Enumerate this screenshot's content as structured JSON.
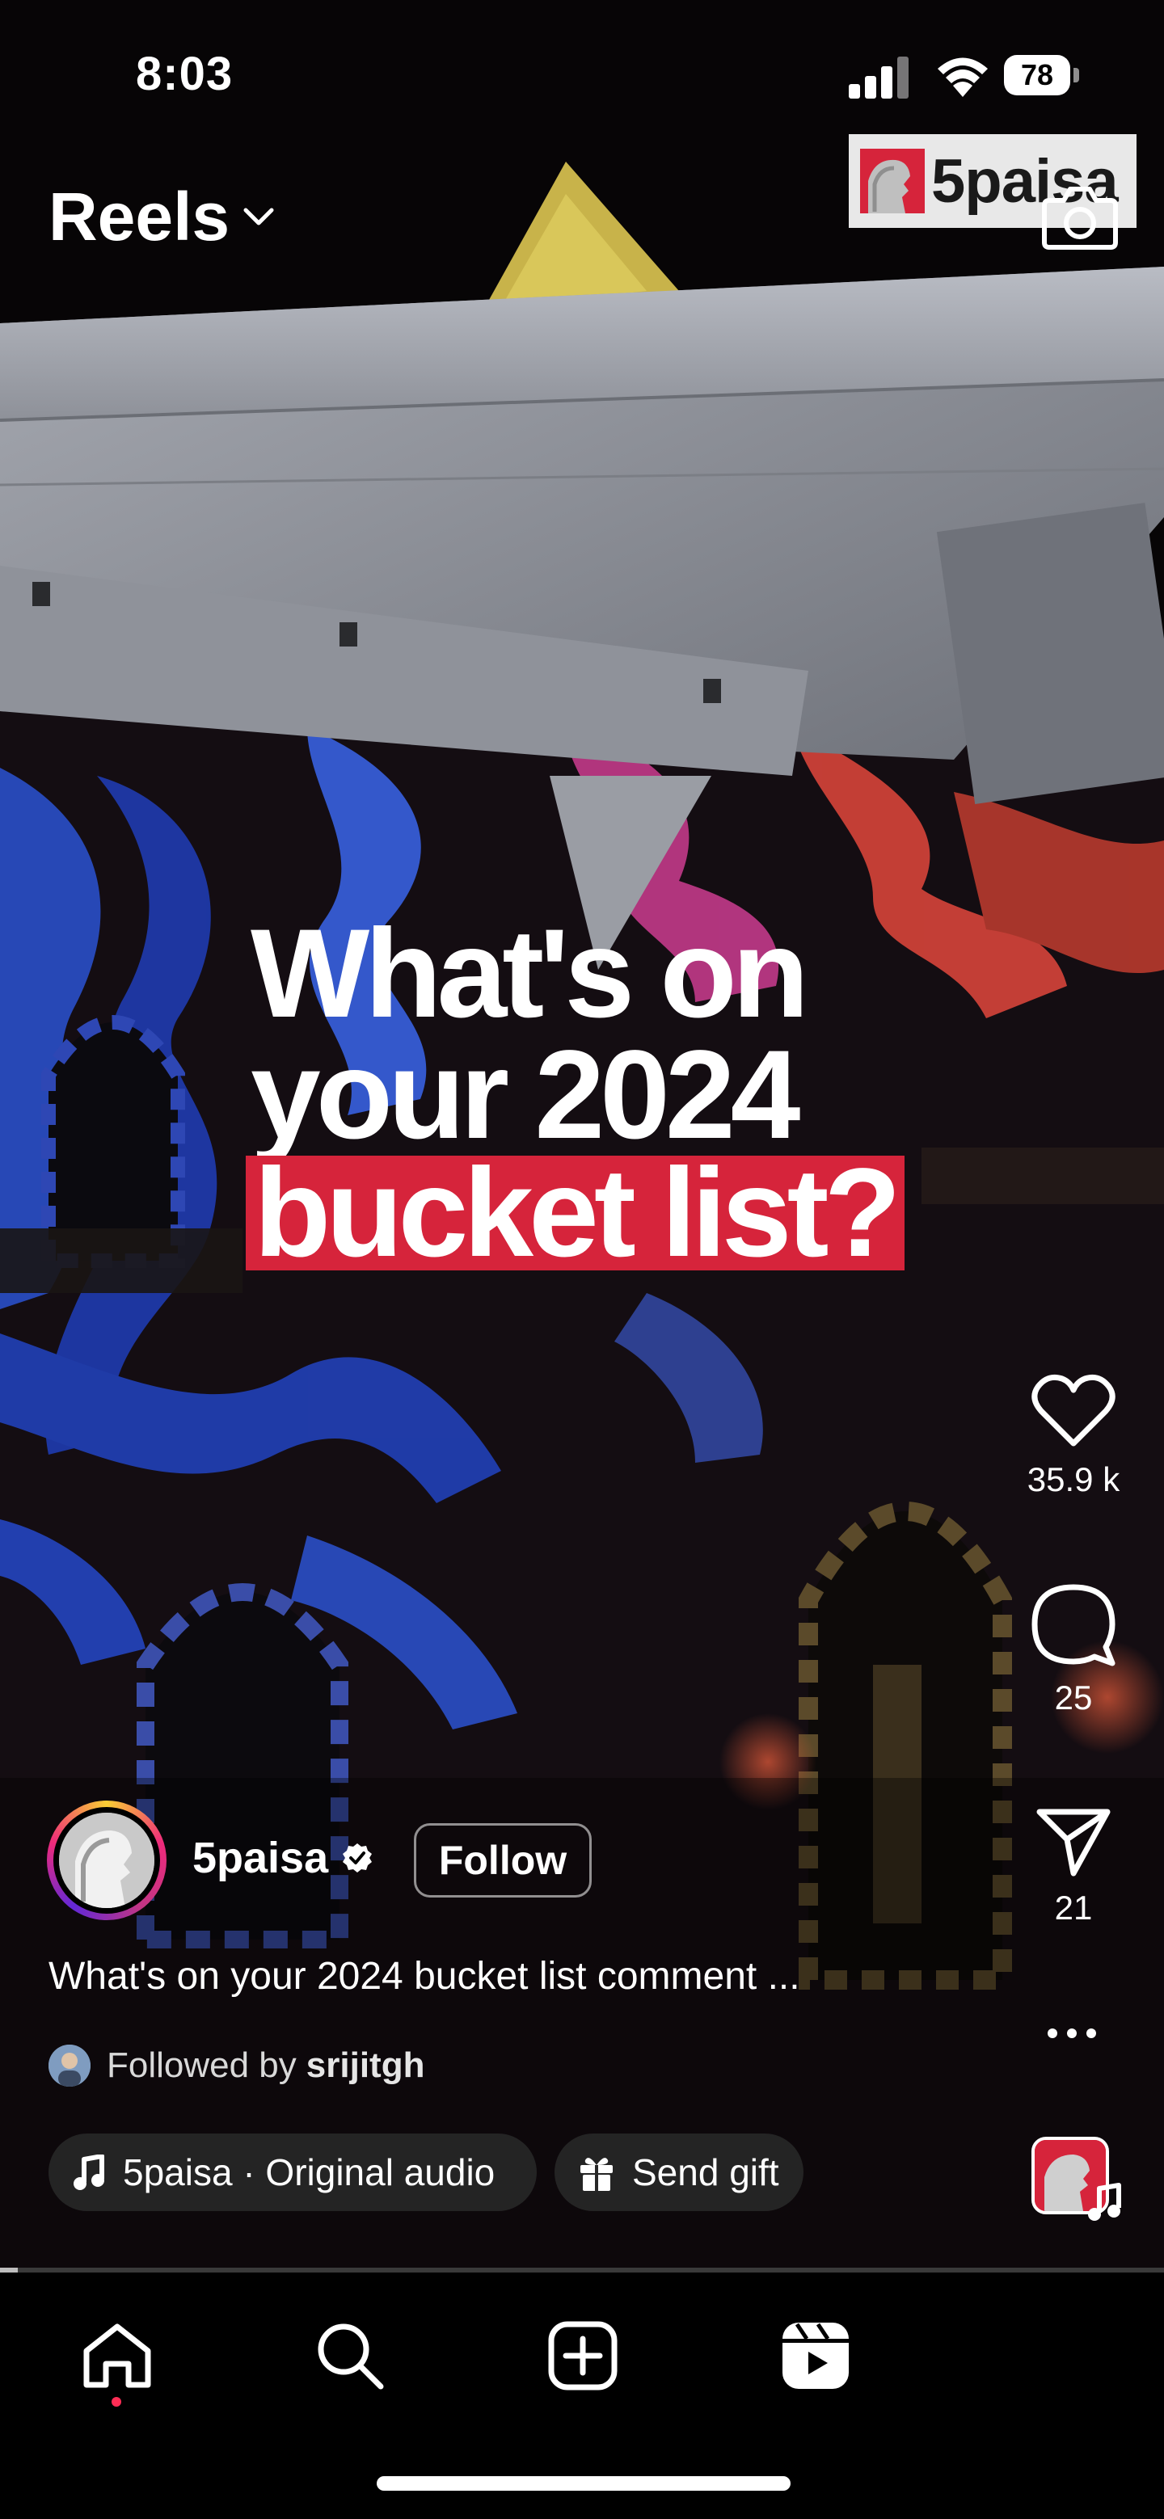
{
  "status_bar": {
    "time": "8:03",
    "battery_level": "78",
    "icons": [
      "cellular-signal-icon",
      "wifi-icon",
      "battery-icon"
    ]
  },
  "header": {
    "title": "Reels",
    "title_icon": "chevron-down-icon",
    "watermark_text": "5paisa",
    "camera_icon": "camera-icon"
  },
  "overlay": {
    "line1": "What's on",
    "line2": "your 2024",
    "line3": "bucket list?",
    "highlight_color": "#d6243b"
  },
  "actions": {
    "like_count": "35.9 k",
    "comment_count": "25",
    "share_count": "21",
    "icons": [
      "heart-icon",
      "comment-icon",
      "send-icon",
      "more-icon"
    ]
  },
  "author": {
    "name": "5paisa",
    "verified": true,
    "follow_label": "Follow"
  },
  "post": {
    "caption": "What's on your 2024 bucket list comment ...",
    "followed_by_prefix": "Followed by",
    "followed_by_user": "srijitgh",
    "audio_label": "5paisa · Original audio",
    "gift_label": "Send gift"
  },
  "playback": {
    "progress_fraction": 0.015
  },
  "nav": {
    "items": [
      "home-icon",
      "search-icon",
      "create-icon",
      "reels-icon"
    ],
    "active": "home",
    "notification_dot_color": "#ff2d55"
  }
}
